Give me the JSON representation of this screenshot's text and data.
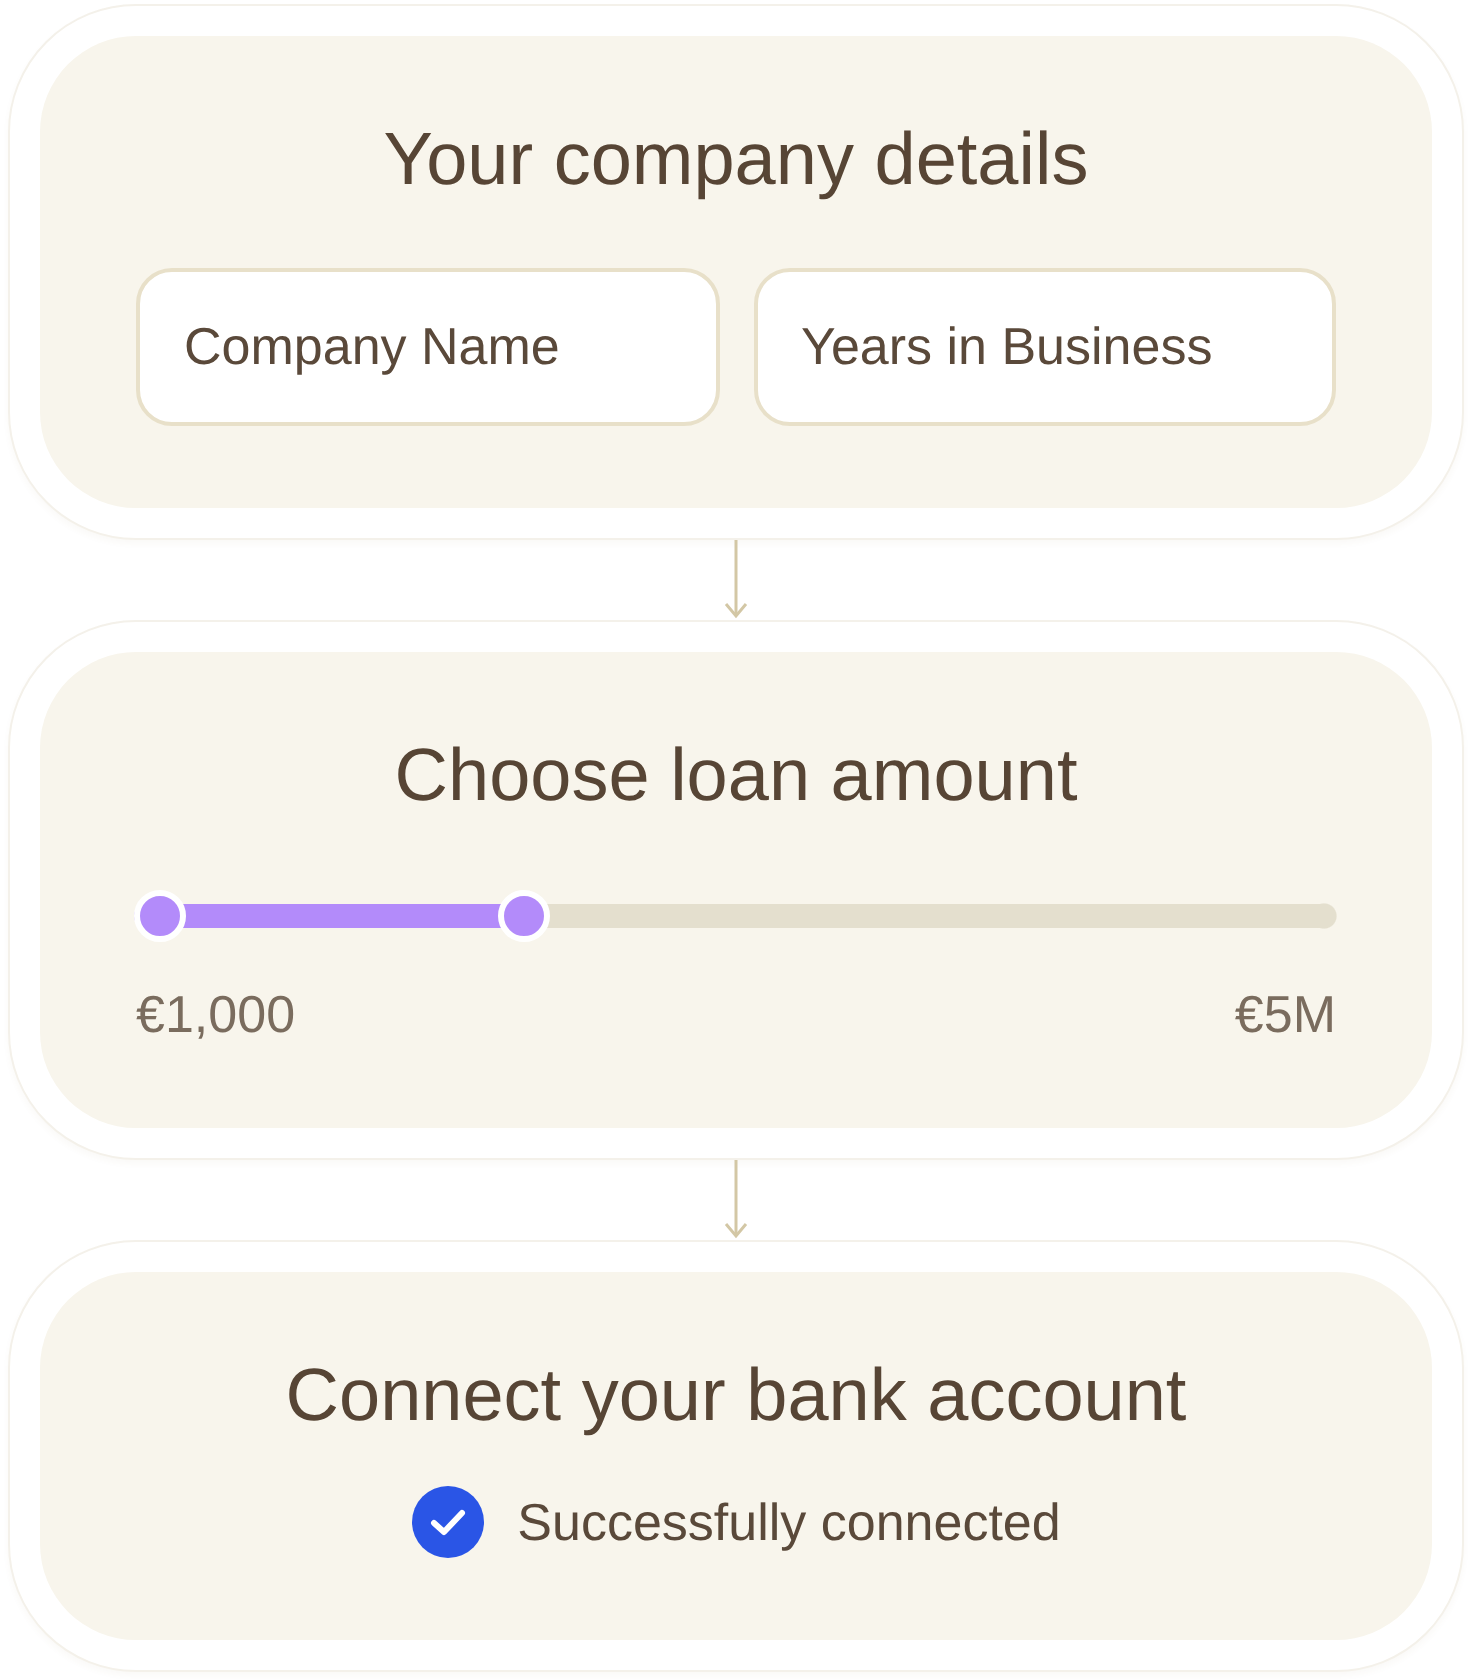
{
  "steps": [
    {
      "kind": "fields",
      "title": "Your company details",
      "fields": [
        {
          "placeholder": "Company Name"
        },
        {
          "placeholder": "Years in Business"
        }
      ]
    },
    {
      "kind": "slider",
      "title": "Choose loan amount",
      "slider": {
        "thumbs": [
          {
            "level": 0
          },
          {
            "level": 0.31
          }
        ],
        "min_label": "€1,000",
        "max_label": "€5M"
      }
    },
    {
      "kind": "status",
      "title": "Connect your bank account",
      "status": {
        "connected": true,
        "text": "Successfully connected"
      }
    }
  ]
}
